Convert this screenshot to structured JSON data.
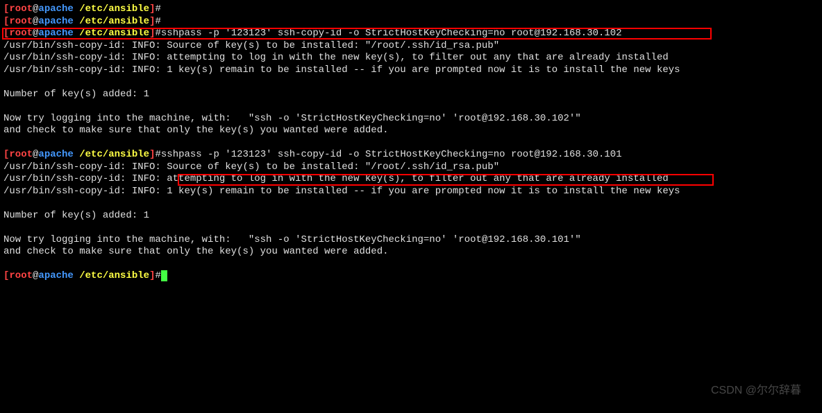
{
  "prompt": {
    "open": "[",
    "user": "root",
    "at": "@",
    "host": "apache",
    "space": " ",
    "path": "/etc/ansible",
    "close": "]",
    "hash": "#"
  },
  "cmd1": "sshpass -p '123123' ssh-copy-id -o StrictHostKeyChecking=no root@192.168.30.102",
  "cmd2": "sshpass -p '123123' ssh-copy-id -o StrictHostKeyChecking=no root@192.168.30.101",
  "block1": {
    "l1": "/usr/bin/ssh-copy-id: INFO: Source of key(s) to be installed: \"/root/.ssh/id_rsa.pub\"",
    "l2": "/usr/bin/ssh-copy-id: INFO: attempting to log in with the new key(s), to filter out any that are already installed",
    "l3": "/usr/bin/ssh-copy-id: INFO: 1 key(s) remain to be installed -- if you are prompted now it is to install the new keys",
    "l4": "Number of key(s) added: 1",
    "l5": "Now try logging into the machine, with:   \"ssh -o 'StrictHostKeyChecking=no' 'root@192.168.30.102'\"",
    "l6": "and check to make sure that only the key(s) you wanted were added."
  },
  "block2": {
    "l1": "/usr/bin/ssh-copy-id: INFO: Source of key(s) to be installed: \"/root/.ssh/id_rsa.pub\"",
    "l2": "/usr/bin/ssh-copy-id: INFO: attempting to log in with the new key(s), to filter out any that are already installed",
    "l3": "/usr/bin/ssh-copy-id: INFO: 1 key(s) remain to be installed -- if you are prompted now it is to install the new keys",
    "l4": "Number of key(s) added: 1",
    "l5": "Now try logging into the machine, with:   \"ssh -o 'StrictHostKeyChecking=no' 'root@192.168.30.101'\"",
    "l6": "and check to make sure that only the key(s) you wanted were added."
  },
  "watermark": "CSDN @尔尔辞暮"
}
